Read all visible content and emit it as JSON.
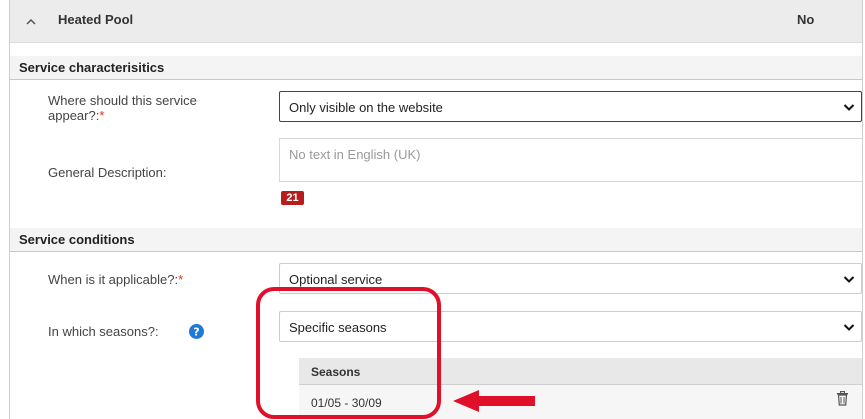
{
  "header": {
    "title": "Heated Pool",
    "value": "No",
    "chevron_icon": "chevron-up-icon"
  },
  "service_characteristics": {
    "title": "Service characterisitics",
    "appear": {
      "label": "Where should this service appear?:",
      "required_mark": "*",
      "value": "Only visible on the website"
    },
    "description": {
      "label": "General Description:",
      "placeholder": "No text in English (UK)",
      "counter": "21"
    }
  },
  "service_conditions": {
    "title": "Service conditions",
    "applicable": {
      "label": "When is it applicable?:",
      "required_mark": "*",
      "value": "Optional service"
    },
    "seasons": {
      "label": "In which seasons?:",
      "help_icon": "help-question-icon",
      "value": "Specific seasons",
      "table_header": "Seasons",
      "rows": [
        {
          "range": "01/05 - 30/09"
        }
      ]
    }
  },
  "annotation": {
    "highlight_color": "#e0102a",
    "arrow_color": "#e0102a"
  },
  "colors": {
    "badge": "#b81c1c",
    "help": "#1e7ad6",
    "section_border": "#f0b8ae"
  }
}
